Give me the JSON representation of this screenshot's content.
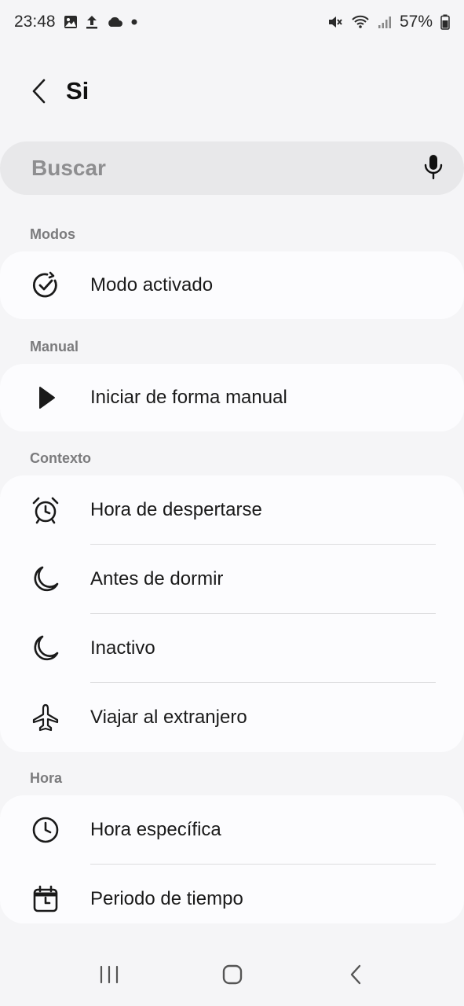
{
  "status_bar": {
    "time": "23:48",
    "battery": "57%"
  },
  "header": {
    "title": "Si"
  },
  "search": {
    "placeholder": "Buscar"
  },
  "sections": {
    "modos": {
      "header": "Modos",
      "items": [
        {
          "label": "Modo activado",
          "icon": "check-circle-icon"
        }
      ]
    },
    "manual": {
      "header": "Manual",
      "items": [
        {
          "label": "Iniciar de forma manual",
          "icon": "play-icon"
        }
      ]
    },
    "contexto": {
      "header": "Contexto",
      "items": [
        {
          "label": "Hora de despertarse",
          "icon": "alarm-clock-icon"
        },
        {
          "label": "Antes de dormir",
          "icon": "moon-icon"
        },
        {
          "label": "Inactivo",
          "icon": "moon-icon"
        },
        {
          "label": "Viajar al extranjero",
          "icon": "airplane-icon"
        }
      ]
    },
    "hora": {
      "header": "Hora",
      "items": [
        {
          "label": "Hora específica",
          "icon": "clock-icon"
        },
        {
          "label": "Periodo de tiempo",
          "icon": "calendar-clock-icon"
        }
      ]
    }
  }
}
